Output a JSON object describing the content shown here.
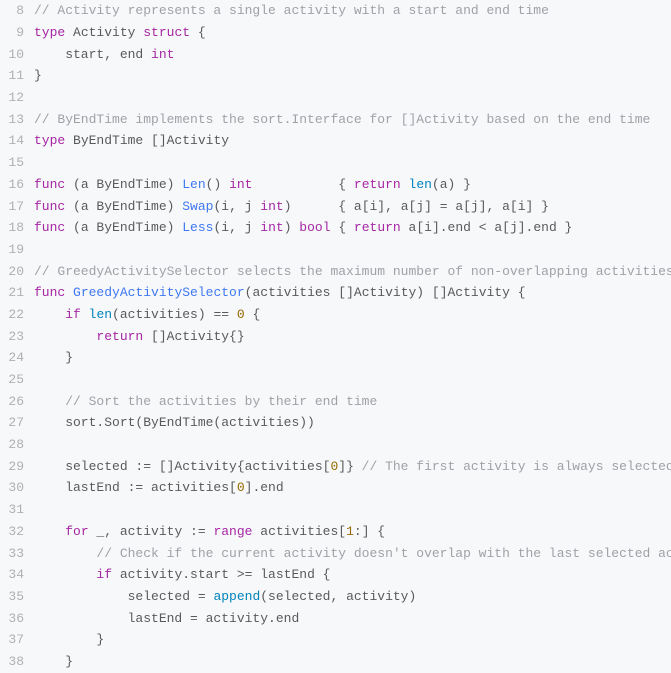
{
  "lines": [
    {
      "num": "8",
      "segs": [
        {
          "c": "comment",
          "t": "// Activity represents a single activity with a start and end time"
        }
      ]
    },
    {
      "num": "9",
      "segs": [
        {
          "c": "kw",
          "t": "type"
        },
        {
          "c": "ident",
          "t": " Activity "
        },
        {
          "c": "kw",
          "t": "struct"
        },
        {
          "c": "punct",
          "t": " {"
        }
      ]
    },
    {
      "num": "10",
      "segs": [
        {
          "c": "ident",
          "t": "    start, end "
        },
        {
          "c": "int-kw",
          "t": "int"
        }
      ]
    },
    {
      "num": "11",
      "segs": [
        {
          "c": "punct",
          "t": "}"
        }
      ]
    },
    {
      "num": "12",
      "segs": []
    },
    {
      "num": "13",
      "segs": [
        {
          "c": "comment",
          "t": "// ByEndTime implements the sort.Interface for []Activity based on the end time"
        }
      ]
    },
    {
      "num": "14",
      "segs": [
        {
          "c": "kw",
          "t": "type"
        },
        {
          "c": "ident",
          "t": " ByEndTime []Activity"
        }
      ]
    },
    {
      "num": "15",
      "segs": []
    },
    {
      "num": "16",
      "segs": [
        {
          "c": "kw",
          "t": "func"
        },
        {
          "c": "punct",
          "t": " (a ByEndTime) "
        },
        {
          "c": "func-name",
          "t": "Len"
        },
        {
          "c": "punct",
          "t": "() "
        },
        {
          "c": "int-kw",
          "t": "int"
        },
        {
          "c": "punct",
          "t": "           { "
        },
        {
          "c": "return-kw",
          "t": "return"
        },
        {
          "c": "punct",
          "t": " "
        },
        {
          "c": "builtin",
          "t": "len"
        },
        {
          "c": "punct",
          "t": "(a) }"
        }
      ]
    },
    {
      "num": "17",
      "segs": [
        {
          "c": "kw",
          "t": "func"
        },
        {
          "c": "punct",
          "t": " (a ByEndTime) "
        },
        {
          "c": "func-name",
          "t": "Swap"
        },
        {
          "c": "punct",
          "t": "(i, j "
        },
        {
          "c": "int-kw",
          "t": "int"
        },
        {
          "c": "punct",
          "t": ")      { a[i], a[j] = a[j], a[i] }"
        }
      ]
    },
    {
      "num": "18",
      "segs": [
        {
          "c": "kw",
          "t": "func"
        },
        {
          "c": "punct",
          "t": " (a ByEndTime) "
        },
        {
          "c": "func-name",
          "t": "Less"
        },
        {
          "c": "punct",
          "t": "(i, j "
        },
        {
          "c": "int-kw",
          "t": "int"
        },
        {
          "c": "punct",
          "t": ") "
        },
        {
          "c": "bool-kw",
          "t": "bool"
        },
        {
          "c": "punct",
          "t": " { "
        },
        {
          "c": "return-kw",
          "t": "return"
        },
        {
          "c": "punct",
          "t": " a[i].end < a[j].end }"
        }
      ]
    },
    {
      "num": "19",
      "segs": []
    },
    {
      "num": "20",
      "segs": [
        {
          "c": "comment",
          "t": "// GreedyActivitySelector selects the maximum number of non-overlapping activities us"
        }
      ]
    },
    {
      "num": "21",
      "segs": [
        {
          "c": "kw",
          "t": "func"
        },
        {
          "c": "punct",
          "t": " "
        },
        {
          "c": "func-name",
          "t": "GreedyActivitySelector"
        },
        {
          "c": "punct",
          "t": "(activities []Activity) []Activity {"
        }
      ]
    },
    {
      "num": "22",
      "segs": [
        {
          "c": "punct",
          "t": "    "
        },
        {
          "c": "kw",
          "t": "if"
        },
        {
          "c": "punct",
          "t": " "
        },
        {
          "c": "builtin",
          "t": "len"
        },
        {
          "c": "punct",
          "t": "(activities) == "
        },
        {
          "c": "num",
          "t": "0"
        },
        {
          "c": "punct",
          "t": " {"
        }
      ]
    },
    {
      "num": "23",
      "segs": [
        {
          "c": "punct",
          "t": "        "
        },
        {
          "c": "return-kw",
          "t": "return"
        },
        {
          "c": "punct",
          "t": " []Activity{}"
        }
      ]
    },
    {
      "num": "24",
      "segs": [
        {
          "c": "punct",
          "t": "    }"
        }
      ]
    },
    {
      "num": "25",
      "segs": []
    },
    {
      "num": "26",
      "segs": [
        {
          "c": "punct",
          "t": "    "
        },
        {
          "c": "comment",
          "t": "// Sort the activities by their end time"
        }
      ]
    },
    {
      "num": "27",
      "segs": [
        {
          "c": "punct",
          "t": "    sort.Sort(ByEndTime(activities))"
        }
      ]
    },
    {
      "num": "28",
      "segs": []
    },
    {
      "num": "29",
      "segs": [
        {
          "c": "punct",
          "t": "    selected := []Activity{activities["
        },
        {
          "c": "num",
          "t": "0"
        },
        {
          "c": "punct",
          "t": "]} "
        },
        {
          "c": "comment",
          "t": "// The first activity is always selected"
        }
      ]
    },
    {
      "num": "30",
      "segs": [
        {
          "c": "punct",
          "t": "    lastEnd := activities["
        },
        {
          "c": "num",
          "t": "0"
        },
        {
          "c": "punct",
          "t": "].end"
        }
      ]
    },
    {
      "num": "31",
      "segs": []
    },
    {
      "num": "32",
      "segs": [
        {
          "c": "punct",
          "t": "    "
        },
        {
          "c": "kw",
          "t": "for"
        },
        {
          "c": "punct",
          "t": " _, activity := "
        },
        {
          "c": "kw",
          "t": "range"
        },
        {
          "c": "punct",
          "t": " activities["
        },
        {
          "c": "num",
          "t": "1"
        },
        {
          "c": "punct",
          "t": ":] {"
        }
      ]
    },
    {
      "num": "33",
      "segs": [
        {
          "c": "punct",
          "t": "        "
        },
        {
          "c": "comment",
          "t": "// Check if the current activity doesn't overlap with the last selected activ"
        }
      ]
    },
    {
      "num": "34",
      "segs": [
        {
          "c": "punct",
          "t": "        "
        },
        {
          "c": "kw",
          "t": "if"
        },
        {
          "c": "punct",
          "t": " activity.start >= lastEnd {"
        }
      ]
    },
    {
      "num": "35",
      "segs": [
        {
          "c": "punct",
          "t": "            selected = "
        },
        {
          "c": "builtin",
          "t": "append"
        },
        {
          "c": "punct",
          "t": "(selected, activity)"
        }
      ]
    },
    {
      "num": "36",
      "segs": [
        {
          "c": "punct",
          "t": "            lastEnd = activity.end"
        }
      ]
    },
    {
      "num": "37",
      "segs": [
        {
          "c": "punct",
          "t": "        }"
        }
      ]
    },
    {
      "num": "38",
      "segs": [
        {
          "c": "punct",
          "t": "    }"
        }
      ]
    }
  ]
}
